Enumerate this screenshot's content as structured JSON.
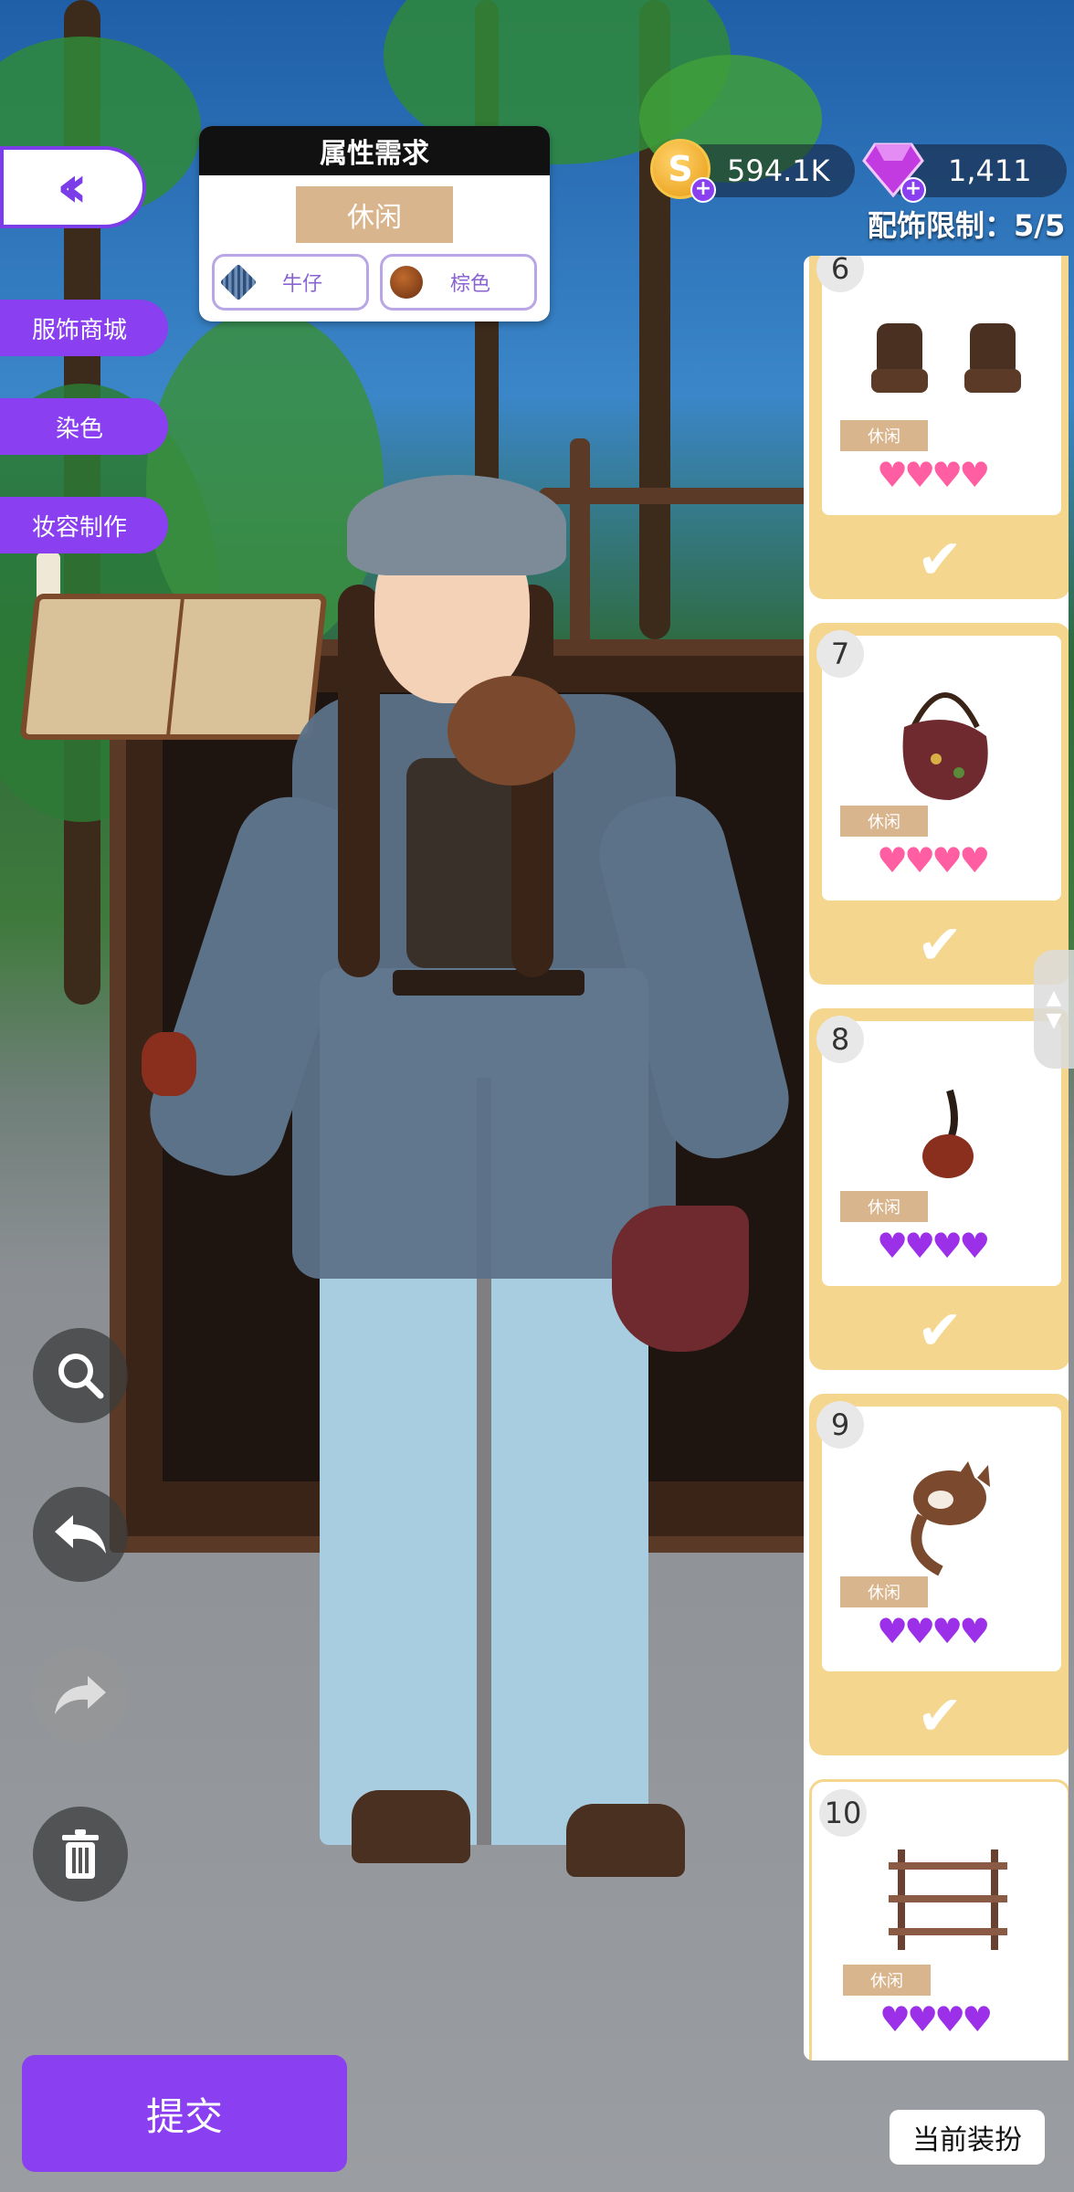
{
  "nav": {
    "back_icon": "double-chevron-left-icon",
    "side_tabs": [
      {
        "label": "服饰商城"
      },
      {
        "label": "染色"
      },
      {
        "label": "妆容制作"
      }
    ]
  },
  "requirements": {
    "title": "属性需求",
    "style_tag": "休闲",
    "chips": [
      {
        "label": "牛仔",
        "icon": "denim-swatch-icon"
      },
      {
        "label": "棕色",
        "icon": "brown-color-icon"
      }
    ]
  },
  "currency": {
    "coins": "594.1K",
    "gems": "1,411",
    "coin_symbol": "S"
  },
  "accessory_limit": "配饰限制：5/5",
  "items": [
    {
      "number": "6",
      "tag": "休闲",
      "hearts": 4,
      "heart_color": "#ff5fa2",
      "image": "platform-boots-icon",
      "selected": true
    },
    {
      "number": "7",
      "tag": "休闲",
      "hearts": 4,
      "heart_color": "#ff5fa2",
      "image": "saddle-bag-icon",
      "selected": true
    },
    {
      "number": "8",
      "tag": "休闲",
      "hearts": 4,
      "heart_color": "#9b30e8",
      "image": "tobacco-pipe-icon",
      "selected": true
    },
    {
      "number": "9",
      "tag": "休闲",
      "hearts": 4,
      "heart_color": "#9b30e8",
      "image": "cat-shoulder-pet-icon",
      "selected": true
    },
    {
      "number": "10",
      "tag": "休闲",
      "hearts": 4,
      "heart_color": "#9b30e8",
      "image": "wooden-shelf-icon",
      "selected": false
    }
  ],
  "tools": [
    {
      "icon": "zoom-icon"
    },
    {
      "icon": "undo-icon"
    },
    {
      "icon": "redo-icon"
    },
    {
      "icon": "trash-icon"
    }
  ],
  "submit_label": "提交",
  "current_outfit_label": "当前装扮",
  "colors": {
    "accent_purple": "#8a3ff0",
    "tag_beige": "#d9b58e",
    "card_yellow": "#f5d68e"
  }
}
